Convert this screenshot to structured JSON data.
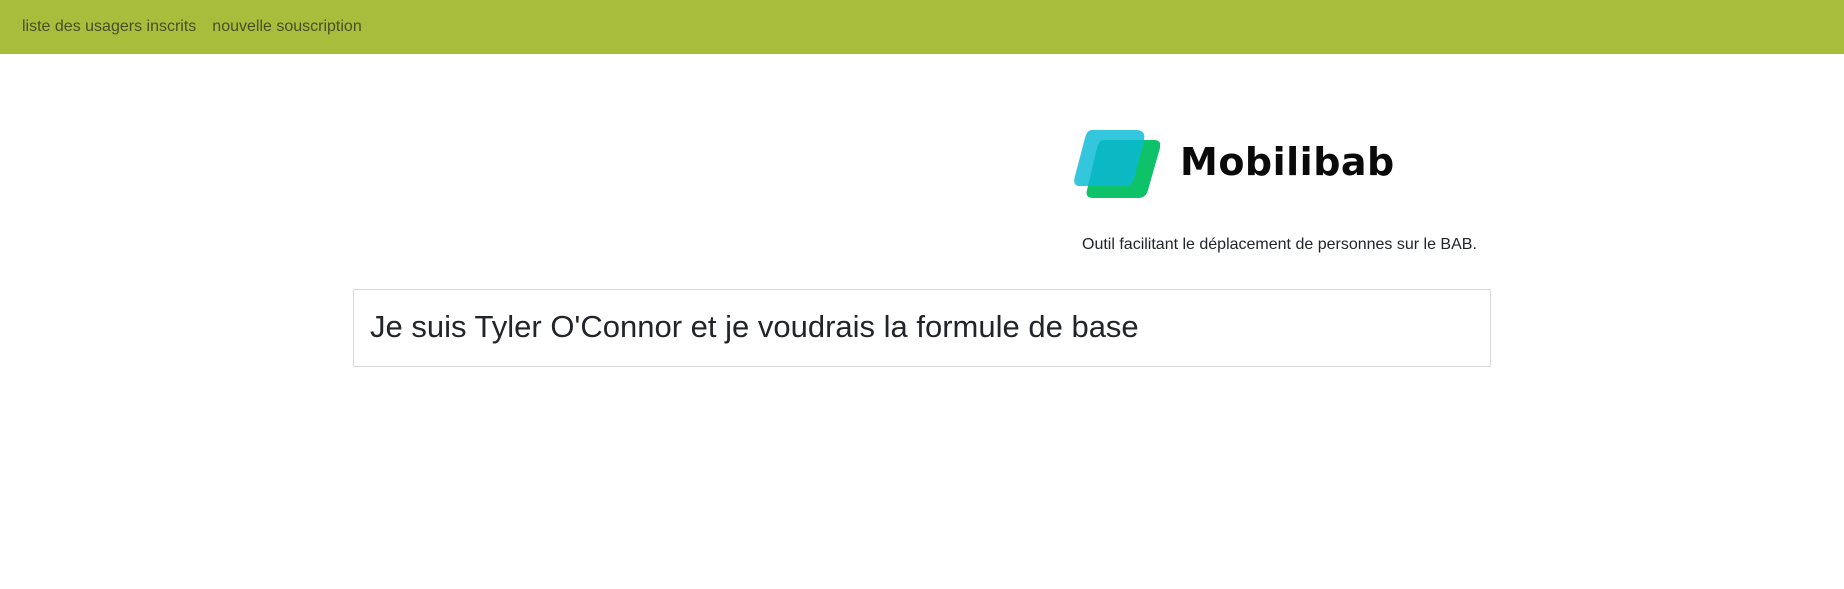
{
  "navbar": {
    "background": "#a8bd3b",
    "links": [
      {
        "label": "liste des usagers inscrits"
      },
      {
        "label": "nouvelle souscription"
      }
    ]
  },
  "brand": {
    "name": "Mobilibab",
    "logo_colors": {
      "back": "#33c6dc",
      "front": "#0ec26a",
      "overlap": "#0ab9c4"
    },
    "tagline": "Outil facilitant le déplacement de personnes sur le BAB."
  },
  "main": {
    "message": "Je suis Tyler O'Connor et je voudrais la formule de base"
  }
}
